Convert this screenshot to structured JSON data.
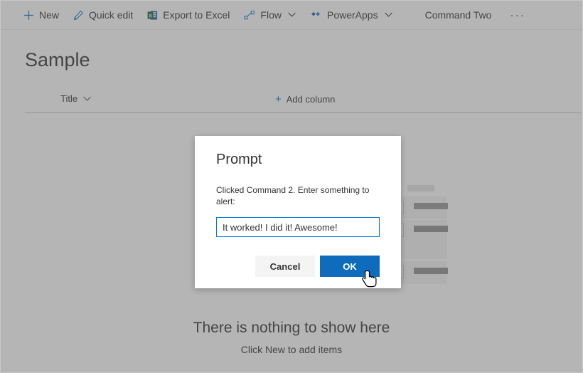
{
  "window": {
    "title": "Sample"
  },
  "commandbar": {
    "items": [
      {
        "id": "new",
        "label": "New",
        "icon": "plus-icon",
        "chevron": false
      },
      {
        "id": "quickedit",
        "label": "Quick edit",
        "icon": "pencil-icon",
        "chevron": false
      },
      {
        "id": "export",
        "label": "Export to Excel",
        "icon": "excel-icon",
        "chevron": false
      },
      {
        "id": "flow",
        "label": "Flow",
        "icon": "flow-icon",
        "chevron": true
      },
      {
        "id": "powerapps",
        "label": "PowerApps",
        "icon": "powerapps-icon",
        "chevron": true
      },
      {
        "id": "command2",
        "label": "Command Two",
        "icon": "none",
        "chevron": false
      },
      {
        "id": "overflow",
        "label": "···",
        "icon": "ellipsis-icon",
        "chevron": false
      }
    ]
  },
  "list": {
    "columns": [
      {
        "id": "title",
        "label": "Title",
        "sortable": true
      },
      {
        "id": "addcolumn",
        "label": "Add column",
        "plus": "+"
      }
    ],
    "empty_state": {
      "heading": "There is nothing to show here",
      "subtext": "Click New to add items"
    }
  },
  "dialog": {
    "title": "Prompt",
    "message": "Clicked Command 2. Enter something to alert:",
    "input": {
      "value": "It worked! I did it! Awesome!",
      "placeholder": ""
    },
    "buttons": {
      "cancel": "Cancel",
      "ok": "OK"
    }
  },
  "colors": {
    "accent": "#0078d4",
    "primary_button": "#0f6cbd",
    "overlay": "#5a5a5a",
    "text": "#333333",
    "excel_green": "#1b6a3f",
    "excel_blue": "#185abd"
  }
}
